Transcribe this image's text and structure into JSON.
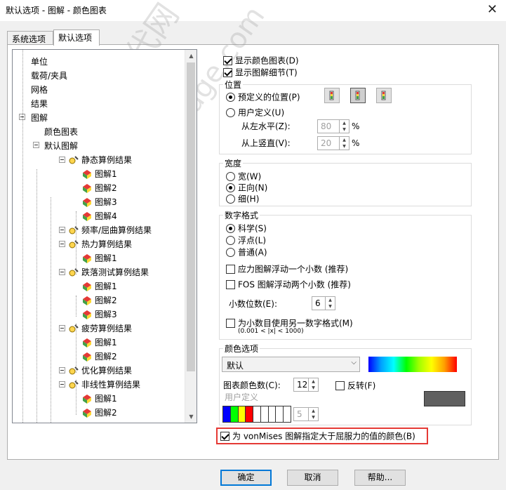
{
  "window": {
    "title": "默认选项 - 图解 - 颜色图表",
    "close_glyph": "✕"
  },
  "tabs": [
    {
      "label": "系统选项"
    },
    {
      "label": "默认选项"
    }
  ],
  "tree": {
    "items": [
      {
        "label": "单位",
        "level": 1
      },
      {
        "label": "载荷/夹具",
        "level": 1
      },
      {
        "label": "网格",
        "level": 1
      },
      {
        "label": "结果",
        "level": 1
      },
      {
        "label": "图解",
        "level": 1
      },
      {
        "label": "颜色图表",
        "level": 2
      },
      {
        "label": "默认图解",
        "level": 2
      },
      {
        "label": "静态算例结果",
        "level": 3
      },
      {
        "label": "图解1",
        "level": 4
      },
      {
        "label": "图解2",
        "level": 4
      },
      {
        "label": "图解3",
        "level": 4
      },
      {
        "label": "图解4",
        "level": 4
      },
      {
        "label": "频率/屈曲算例结果",
        "level": 3
      },
      {
        "label": "热力算例结果",
        "level": 3
      },
      {
        "label": "图解1",
        "level": 4
      },
      {
        "label": "跌落测试算例结果",
        "level": 3
      },
      {
        "label": "图解1",
        "level": 4
      },
      {
        "label": "图解2",
        "level": 4
      },
      {
        "label": "图解3",
        "level": 4
      },
      {
        "label": "疲劳算例结果",
        "level": 3
      },
      {
        "label": "图解1",
        "level": 4
      },
      {
        "label": "图解2",
        "level": 4
      },
      {
        "label": "优化算例结果",
        "level": 3
      },
      {
        "label": "非线性算例结果",
        "level": 3
      },
      {
        "label": "图解1",
        "level": 4
      },
      {
        "label": "图解2",
        "level": 4
      }
    ]
  },
  "options": {
    "show_color_chart": "显示颜色图表(D)",
    "show_plot_details": "显示图解细节(T)"
  },
  "position": {
    "title": "位置",
    "predefined": "预定义的位置(P)",
    "user_defined": "用户定义(U)",
    "from_left": "从左水平(Z):",
    "from_left_value": "80",
    "from_top": "从上竖直(V):",
    "from_top_value": "20",
    "percent": "%"
  },
  "width": {
    "title": "宽度",
    "wide": "宽(W)",
    "normal": "正向(N)",
    "thin": "细(H)"
  },
  "number_format": {
    "title": "数字格式",
    "scientific": "科学(S)",
    "float": "浮点(L)",
    "general": "普通(A)",
    "stress_float": "应力图解浮动一个小数 (推荐)",
    "fos_float": "FOS 图解浮动两个小数 (推荐)",
    "decimals_label": "小数位数(E):",
    "decimals_value": "6",
    "small_numbers": "为小数目使用另一数字格式(M)",
    "small_numbers_range": "(0.001 < |x| < 1000)"
  },
  "color_options": {
    "title": "颜色选项",
    "scheme": "默认",
    "chart_colors_label": "图表颜色数(C):",
    "chart_colors_value": "12",
    "reverse": "反转(F)",
    "user_defined": "用户定义",
    "user_colors_value": "5",
    "swatch_colors": [
      "#0000ff",
      "#00ff00",
      "#ffff00",
      "#ff0000",
      "#ffffff",
      "#ffffff",
      "#ffffff",
      "#ffffff",
      "#ffffff"
    ],
    "preview_color": "#606060"
  },
  "vonmises": {
    "label": "为 vonMises 图解指定大于屈服力的值的颜色(B)"
  },
  "buttons": {
    "ok": "确定",
    "cancel": "取消",
    "help": "帮助..."
  },
  "watermark": {
    "cn": "机械时代网",
    "url": "www.jxage.com"
  }
}
